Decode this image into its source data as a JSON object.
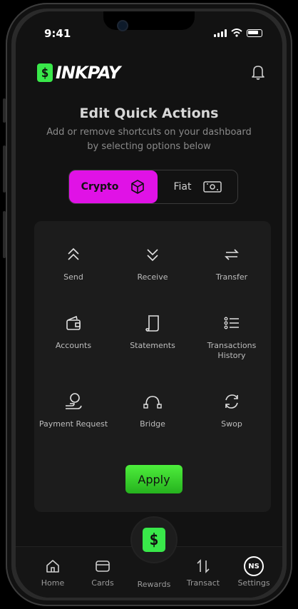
{
  "status": {
    "time": "9:41"
  },
  "brand": {
    "logo_mark": "$",
    "logo_text": "INKPAY"
  },
  "header": {
    "title": "Edit Quick Actions",
    "subtitle": "Add or remove shortcuts on your dashboard by selecting options below"
  },
  "toggle": {
    "crypto_label": "Crypto",
    "fiat_label": "Fiat",
    "selected": "Crypto",
    "accent": "#e012e6"
  },
  "actions": [
    {
      "label": "Send",
      "icon": "double-chevron-up-icon"
    },
    {
      "label": "Receive",
      "icon": "double-chevron-down-icon"
    },
    {
      "label": "Transfer",
      "icon": "arrows-left-right-icon"
    },
    {
      "label": "Accounts",
      "icon": "wallet-icon"
    },
    {
      "label": "Statements",
      "icon": "scroll-icon"
    },
    {
      "label": "Transactions History",
      "icon": "list-icon"
    },
    {
      "label": "Payment Request",
      "icon": "hand-request-icon"
    },
    {
      "label": "Bridge",
      "icon": "bridge-icon"
    },
    {
      "label": "Swop",
      "icon": "refresh-icon"
    }
  ],
  "apply_label": "Apply",
  "tabbar": {
    "items": [
      {
        "label": "Home",
        "icon": "home-icon"
      },
      {
        "label": "Cards",
        "icon": "card-icon"
      },
      {
        "label": "Rewards",
        "icon": "rewards-icon"
      },
      {
        "label": "Transact",
        "icon": "transact-icon"
      },
      {
        "label": "Settings",
        "icon": "avatar",
        "avatar_initials": "NS"
      }
    ]
  },
  "colors": {
    "brand_green": "#39e84a",
    "background": "#121212",
    "panel": "#1c1c1c"
  }
}
